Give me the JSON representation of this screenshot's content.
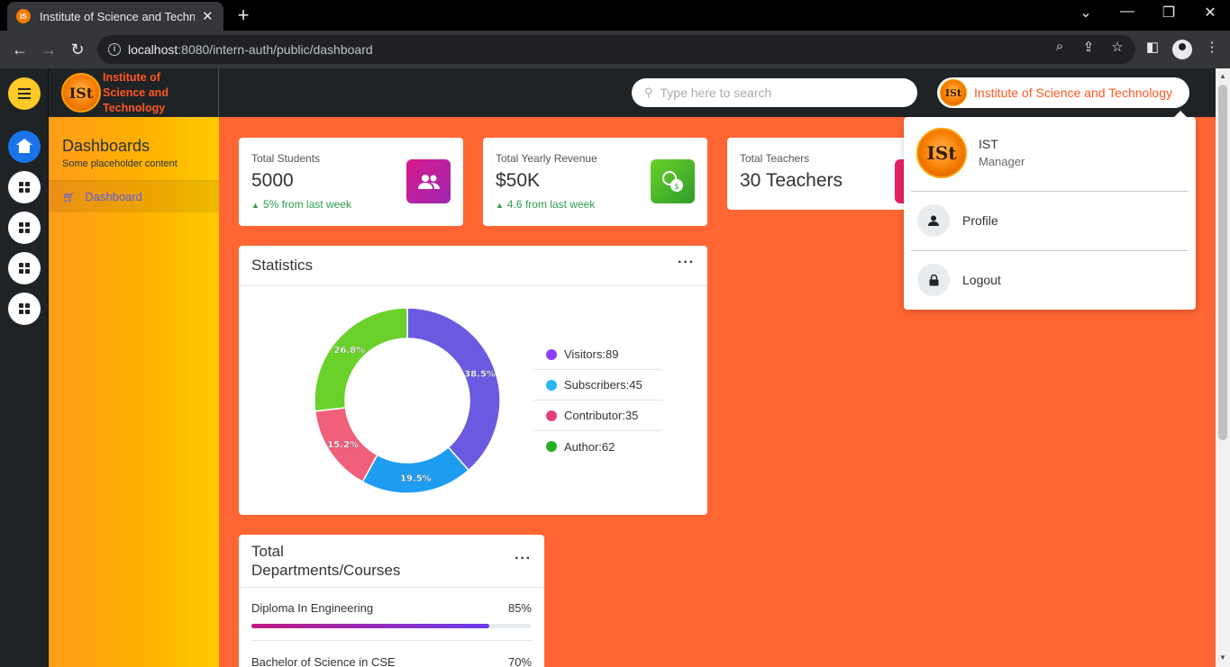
{
  "browser": {
    "tab_title": "Institute of Science and Technology",
    "url_host": "localhost",
    "url_rest": ":8080/intern-auth/public/dashboard"
  },
  "brand": {
    "name": "Institute of Science and Technology",
    "logo_text": "ISt"
  },
  "search": {
    "placeholder": "Type here to search"
  },
  "header_user": {
    "name": "Institute of Science and Technology"
  },
  "sidebar": {
    "title": "Dashboards",
    "subtitle": "Some placeholder content",
    "items": [
      {
        "label": "Dashboard",
        "icon": "cart-icon"
      }
    ]
  },
  "rail": {
    "buttons": [
      "menu-icon",
      "home-icon",
      "grid-icon",
      "grid-icon",
      "grid-icon",
      "grid-icon"
    ]
  },
  "stats": [
    {
      "label": "Total Students",
      "value": "5000",
      "trend": "5% from last week",
      "icon": "users-icon",
      "color": "#c2179a"
    },
    {
      "label": "Total Yearly Revenue",
      "value": "$50K",
      "trend": "4.6 from last week",
      "icon": "money-icon",
      "color": "#43b02a"
    },
    {
      "label": "Total Teachers",
      "value": "30 Teachers",
      "icon": "teacher-icon",
      "color": "#e91e63"
    }
  ],
  "statistics": {
    "title": "Statistics",
    "legend": [
      {
        "label": "Visitors:89",
        "color": "#8a3ffc"
      },
      {
        "label": "Subscribers:45",
        "color": "#29b6f6"
      },
      {
        "label": "Contributor:35",
        "color": "#e63e7a"
      },
      {
        "label": "Author:62",
        "color": "#22b022"
      }
    ]
  },
  "chart_data": {
    "type": "pie",
    "categories": [
      "Visitors",
      "Subscribers",
      "Contributor",
      "Author"
    ],
    "values": [
      89,
      45,
      35,
      62
    ],
    "percent_labels": [
      "38.5%",
      "19.5%",
      "15.2%",
      "26.8%"
    ],
    "colors": [
      "#6a5ae0",
      "#1e9cf0",
      "#f0607a",
      "#6ad12a"
    ],
    "donut": true
  },
  "departments": {
    "title_line1": "Total",
    "title_line2": "Departments/Courses",
    "items": [
      {
        "label": "Diploma In Engineering",
        "percent_text": "85%",
        "percent": 85
      },
      {
        "label": "Bachelor of Science in CSE",
        "percent_text": "70%",
        "percent": 70
      }
    ]
  },
  "user_menu": {
    "name": "IST",
    "role": "Manager",
    "items": [
      {
        "label": "Profile",
        "icon": "person-icon"
      },
      {
        "label": "Logout",
        "icon": "lock-icon"
      }
    ]
  }
}
